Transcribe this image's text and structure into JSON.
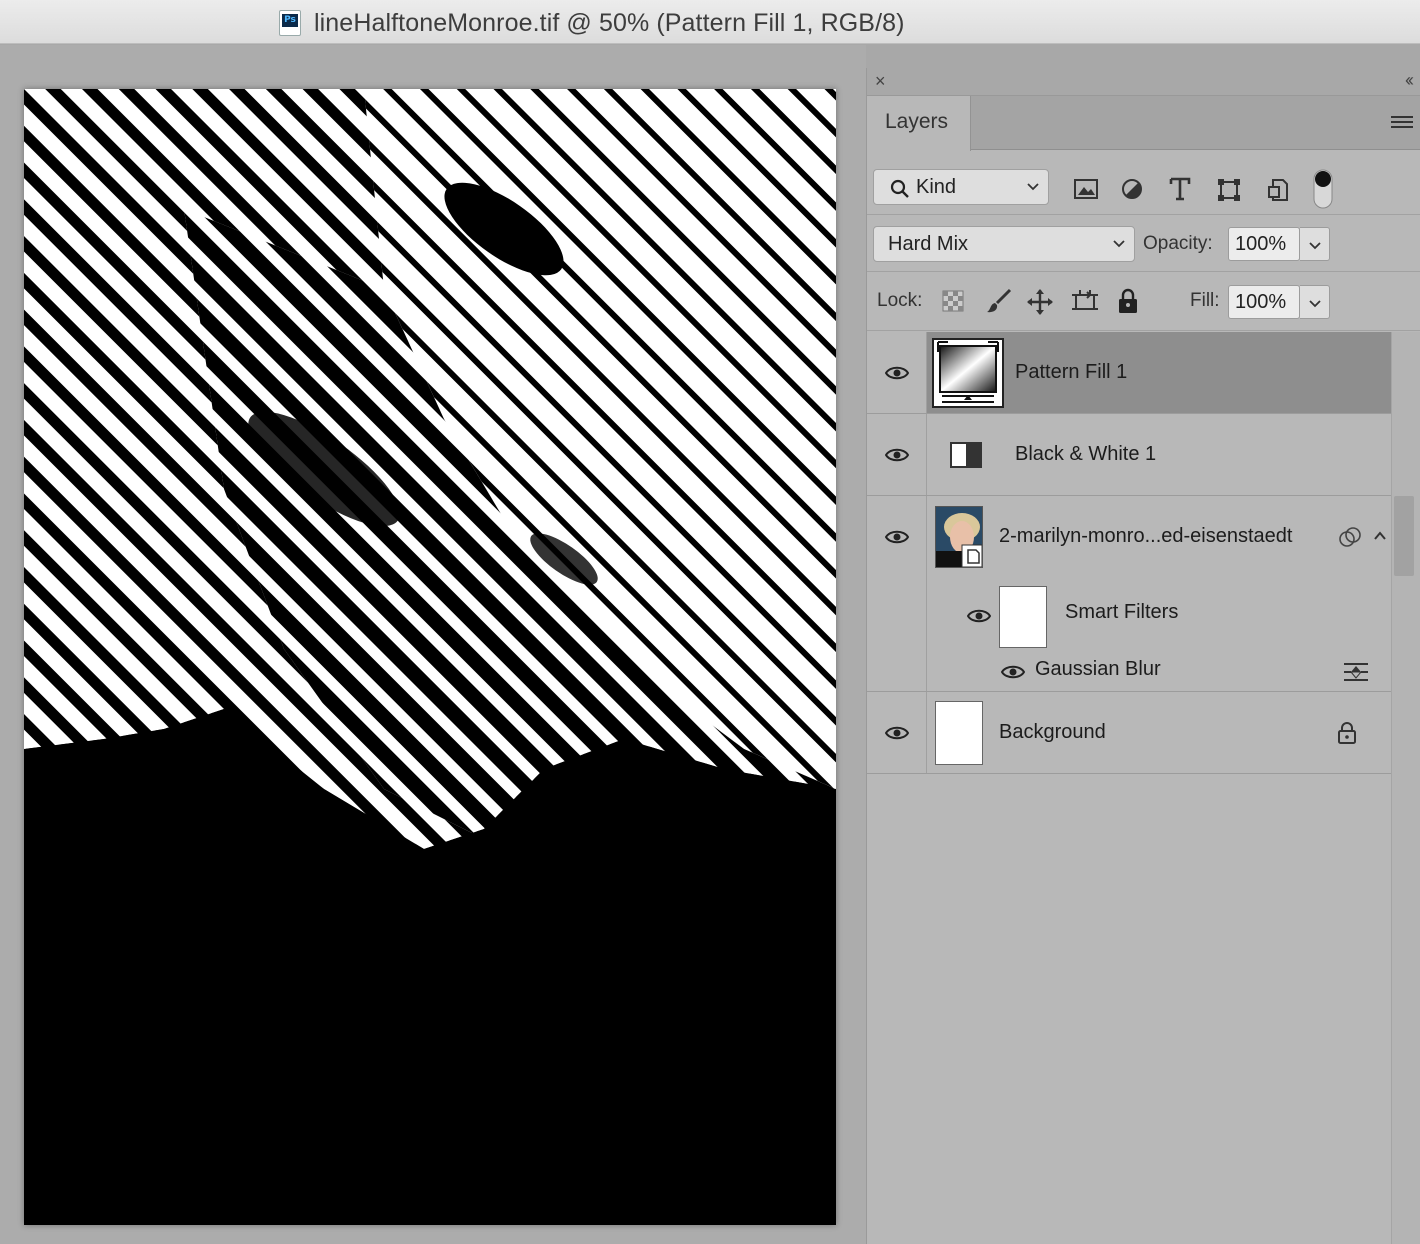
{
  "window": {
    "title": "lineHalftoneMonroe.tif @ 50% (Pattern Fill 1, RGB/8)",
    "app_badge": "Ps"
  },
  "panel": {
    "close_glyph": "×",
    "collapse_glyph": "‹‹",
    "tab_label": "Layers",
    "filter": {
      "label": "Kind",
      "icons": [
        "image-filter-icon",
        "adjustment-filter-icon",
        "type-filter-icon",
        "shape-filter-icon",
        "smart-object-filter-icon",
        "filter-toggle"
      ]
    },
    "blend_mode": "Hard Mix",
    "opacity_label": "Opacity:",
    "opacity_value": "100%",
    "lock_label": "Lock:",
    "fill_label": "Fill:",
    "fill_value": "100%"
  },
  "layers": [
    {
      "name": "Pattern Fill 1",
      "type": "fill",
      "visible": true,
      "selected": true
    },
    {
      "name": "Black & White 1",
      "type": "adjustment",
      "visible": true,
      "selected": false
    },
    {
      "name": "2-marilyn-monro...ed-eisenstaedt",
      "type": "smart-object",
      "visible": true,
      "selected": false
    },
    {
      "name": "Smart Filters",
      "type": "smart-filters",
      "visible": true
    },
    {
      "name": "Gaussian Blur",
      "type": "filter",
      "visible": true
    },
    {
      "name": "Background",
      "type": "background",
      "visible": true,
      "locked": true
    }
  ]
}
